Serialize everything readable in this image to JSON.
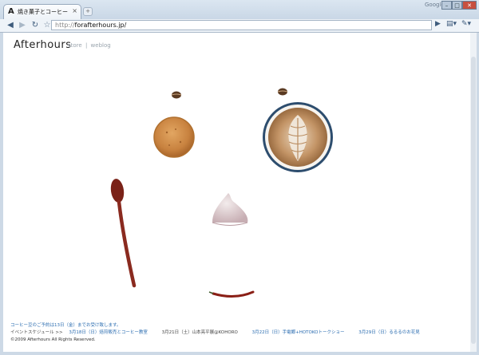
{
  "browser": {
    "tab_title": "焼き菓子とコーヒー｜…",
    "tab_favicon": "A",
    "tab_close": "×",
    "newtab": "+",
    "google_label": "Google",
    "url_prefix": "http://",
    "url_host": "forafterhours.jp/"
  },
  "site": {
    "logo": "Afterhours",
    "nav": [
      "store",
      "weblog"
    ],
    "nav_separator": "|"
  },
  "footer": {
    "reserve_text": "コーヒー豆のご予約は13日（金）までお受け致します。",
    "events_label": "イベントスケジュール >>",
    "events": [
      "3月18日（日）焙煎販売とコーヒー教室",
      "3月21日（土）山本亮平展@KOHORO",
      "3月22日（日）手電郷+HOTOKOトークショー",
      "3月29日（日）るるるのお花見"
    ],
    "copyright": "©2009 Afterhours All Rights Reserved."
  },
  "colors": {
    "link": "#2a6cb0",
    "cookie": "#d08a46",
    "latte": "#b98b5e",
    "spoon": "#8a2a1f"
  }
}
